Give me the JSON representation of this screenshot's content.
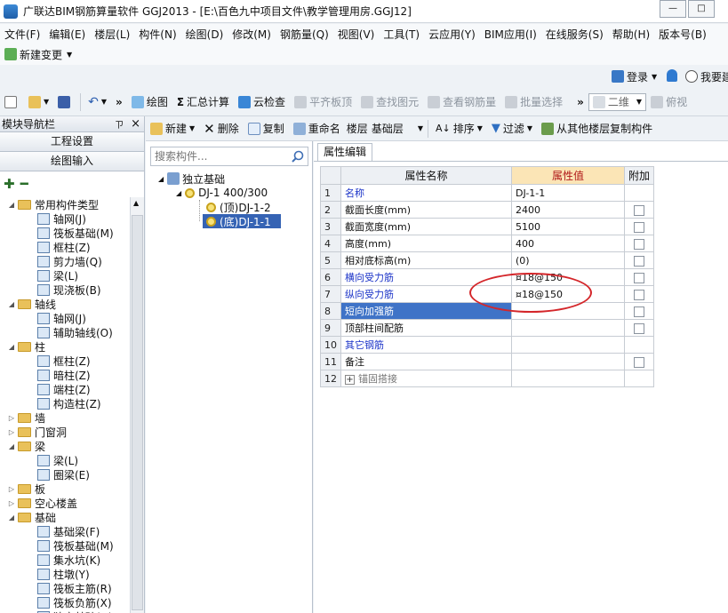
{
  "window": {
    "title": "广联达BIM钢筋算量软件 GGJ2013 - [E:\\百色九中项目文件\\教学管理用房.GGJ12]"
  },
  "menu": [
    "文件(F)",
    "编辑(E)",
    "楼层(L)",
    "构件(N)",
    "绘图(D)",
    "修改(M)",
    "钢筋量(Q)",
    "视图(V)",
    "工具(T)",
    "云应用(Y)",
    "BIM应用(I)",
    "在线服务(S)",
    "帮助(H)",
    "版本号(B)"
  ],
  "change_bar": {
    "new_change": "新建变更"
  },
  "login_bar": {
    "login": "登录",
    "want": "我要建"
  },
  "toolbar1": {
    "draw": "绘图",
    "sum": "汇总计算",
    "cloud_check": "云检查",
    "level_slab": "平齐板顶",
    "find_elem": "查找图元",
    "view_rebar": "查看钢筋量",
    "batch_select": "批量选择",
    "view_mode": "二维",
    "top_view": "俯视"
  },
  "nav": {
    "header": "模块导航栏",
    "pin": "ㄗ",
    "close": "×",
    "project_settings": "工程设置",
    "draw_input": "绘图输入",
    "tree": [
      {
        "label": "常用构件类型",
        "level": 1,
        "toggle": "◢",
        "icon": "folder"
      },
      {
        "label": "轴网(J)",
        "level": 2,
        "icon": "comp"
      },
      {
        "label": "筏板基础(M)",
        "level": 2,
        "icon": "comp"
      },
      {
        "label": "框柱(Z)",
        "level": 2,
        "icon": "comp"
      },
      {
        "label": "剪力墙(Q)",
        "level": 2,
        "icon": "comp"
      },
      {
        "label": "梁(L)",
        "level": 2,
        "icon": "comp"
      },
      {
        "label": "现浇板(B)",
        "level": 2,
        "icon": "comp"
      },
      {
        "label": "轴线",
        "level": 1,
        "toggle": "◢",
        "icon": "folder"
      },
      {
        "label": "轴网(J)",
        "level": 2,
        "icon": "comp"
      },
      {
        "label": "辅助轴线(O)",
        "level": 2,
        "icon": "comp"
      },
      {
        "label": "柱",
        "level": 1,
        "toggle": "◢",
        "icon": "folder"
      },
      {
        "label": "框柱(Z)",
        "level": 2,
        "icon": "comp"
      },
      {
        "label": "暗柱(Z)",
        "level": 2,
        "icon": "comp"
      },
      {
        "label": "端柱(Z)",
        "level": 2,
        "icon": "comp"
      },
      {
        "label": "构造柱(Z)",
        "level": 2,
        "icon": "comp"
      },
      {
        "label": "墙",
        "level": 1,
        "toggle": "▷",
        "icon": "folder"
      },
      {
        "label": "门窗洞",
        "level": 1,
        "toggle": "▷",
        "icon": "folder"
      },
      {
        "label": "梁",
        "level": 1,
        "toggle": "◢",
        "icon": "folder"
      },
      {
        "label": "梁(L)",
        "level": 2,
        "icon": "comp"
      },
      {
        "label": "圈梁(E)",
        "level": 2,
        "icon": "comp"
      },
      {
        "label": "板",
        "level": 1,
        "toggle": "▷",
        "icon": "folder"
      },
      {
        "label": "空心楼盖",
        "level": 1,
        "toggle": "▷",
        "icon": "folder"
      },
      {
        "label": "基础",
        "level": 1,
        "toggle": "◢",
        "icon": "folder"
      },
      {
        "label": "基础梁(F)",
        "level": 2,
        "icon": "comp"
      },
      {
        "label": "筏板基础(M)",
        "level": 2,
        "icon": "comp"
      },
      {
        "label": "集水坑(K)",
        "level": 2,
        "icon": "comp"
      },
      {
        "label": "柱墩(Y)",
        "level": 2,
        "icon": "comp"
      },
      {
        "label": "筏板主筋(R)",
        "level": 2,
        "icon": "comp"
      },
      {
        "label": "筏板负筋(X)",
        "level": 2,
        "icon": "comp"
      },
      {
        "label": "独立基础(D)",
        "level": 2,
        "icon": "comp"
      }
    ]
  },
  "toolbar2": {
    "new": "新建",
    "delete": "删除",
    "copy": "复制",
    "rename": "重命名",
    "floor_label": "楼层",
    "floor_value": "基础层",
    "sort": "排序",
    "filter": "过滤",
    "copy_from": "从其他楼层复制构件"
  },
  "component_tree": {
    "search_placeholder": "搜索构件...",
    "root": "独立基础",
    "item": "DJ-1 400/300",
    "child_top": "(顶)DJ-1-2",
    "child_bottom": "(底)DJ-1-1"
  },
  "properties": {
    "tab": "属性编辑",
    "headers": {
      "name": "属性名称",
      "value": "属性值",
      "extra": "附加"
    },
    "rows": [
      {
        "num": "1",
        "name": "名称",
        "value": "DJ-1-1",
        "blue": true,
        "checkbox": false
      },
      {
        "num": "2",
        "name": "截面长度(mm)",
        "value": "2400",
        "blue": false,
        "checkbox": true
      },
      {
        "num": "3",
        "name": "截面宽度(mm)",
        "value": "5100",
        "blue": false,
        "checkbox": true
      },
      {
        "num": "4",
        "name": "高度(mm)",
        "value": "400",
        "blue": false,
        "checkbox": true
      },
      {
        "num": "5",
        "name": "相对底标高(m)",
        "value": "(0)",
        "blue": false,
        "checkbox": true
      },
      {
        "num": "6",
        "name": "横向受力筋",
        "value": "¤18@150",
        "blue": true,
        "checkbox": true
      },
      {
        "num": "7",
        "name": "纵向受力筋",
        "value": "¤18@150",
        "blue": true,
        "checkbox": true
      },
      {
        "num": "8",
        "name": "短向加强筋",
        "value": "",
        "blue": true,
        "checkbox": true,
        "selected": true
      },
      {
        "num": "9",
        "name": "顶部柱间配筋",
        "value": "",
        "blue": false,
        "checkbox": true
      },
      {
        "num": "10",
        "name": "其它钢筋",
        "value": "",
        "blue": true,
        "checkbox": false
      },
      {
        "num": "11",
        "name": "备注",
        "value": "",
        "blue": false,
        "checkbox": true
      },
      {
        "num": "12",
        "name": "锚固搭接",
        "value": "",
        "blue": false,
        "checkbox": false,
        "expandable": true,
        "expand": "+"
      }
    ]
  },
  "colors": {
    "highlight_ellipse": "#d4262a",
    "selection": "#3f73c7",
    "value_header": "#fbe5b6"
  }
}
